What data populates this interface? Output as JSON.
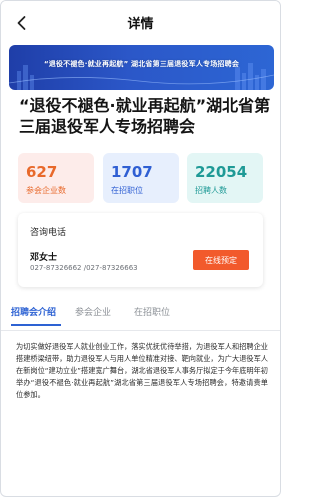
{
  "nav": {
    "title": "详情",
    "back_icon": "chevron-left-icon"
  },
  "banner": {
    "text": "“退役不褪色·就业再起航” 湖北省第三届退役军人专场招聘会",
    "colors": {
      "start": "#1f3ea8",
      "end": "#2d66d4"
    }
  },
  "heading": "“退役不褪色·就业再起航”湖北省第三届退役军人专场招聘会",
  "stats": [
    {
      "value": "627",
      "label": "参会企业数",
      "color": "#e8692b"
    },
    {
      "value": "1707",
      "label": "在招职位",
      "color": "#2f5fd3"
    },
    {
      "value": "22054",
      "label": "招聘人数",
      "color": "#1f9a96"
    }
  ],
  "contact": {
    "title": "咨询电话",
    "name": "邓女士",
    "phone": "027-87326662 /027-87326663",
    "book_label": "在线预定",
    "book_color": "#f25a2c"
  },
  "tabs": [
    {
      "label": "招聘会介绍",
      "active": true
    },
    {
      "label": "参会企业",
      "active": false
    },
    {
      "label": "在招职位",
      "active": false
    }
  ],
  "intro": "为切实做好退役军人就业创业工作，落实优抚优待举措，为退役军人和招聘企业搭建桥梁纽带，助力退役军人与用人单位精准对接、靶向就业，为广大退役军人在新岗位“建功立业”搭建宽广舞台，湖北省退役军人事务厅拟定于今年底明年初举办“退役不褪色·就业再起航”湖北省第三届退役军人专场招聘会，特邀请贵单位参加。"
}
